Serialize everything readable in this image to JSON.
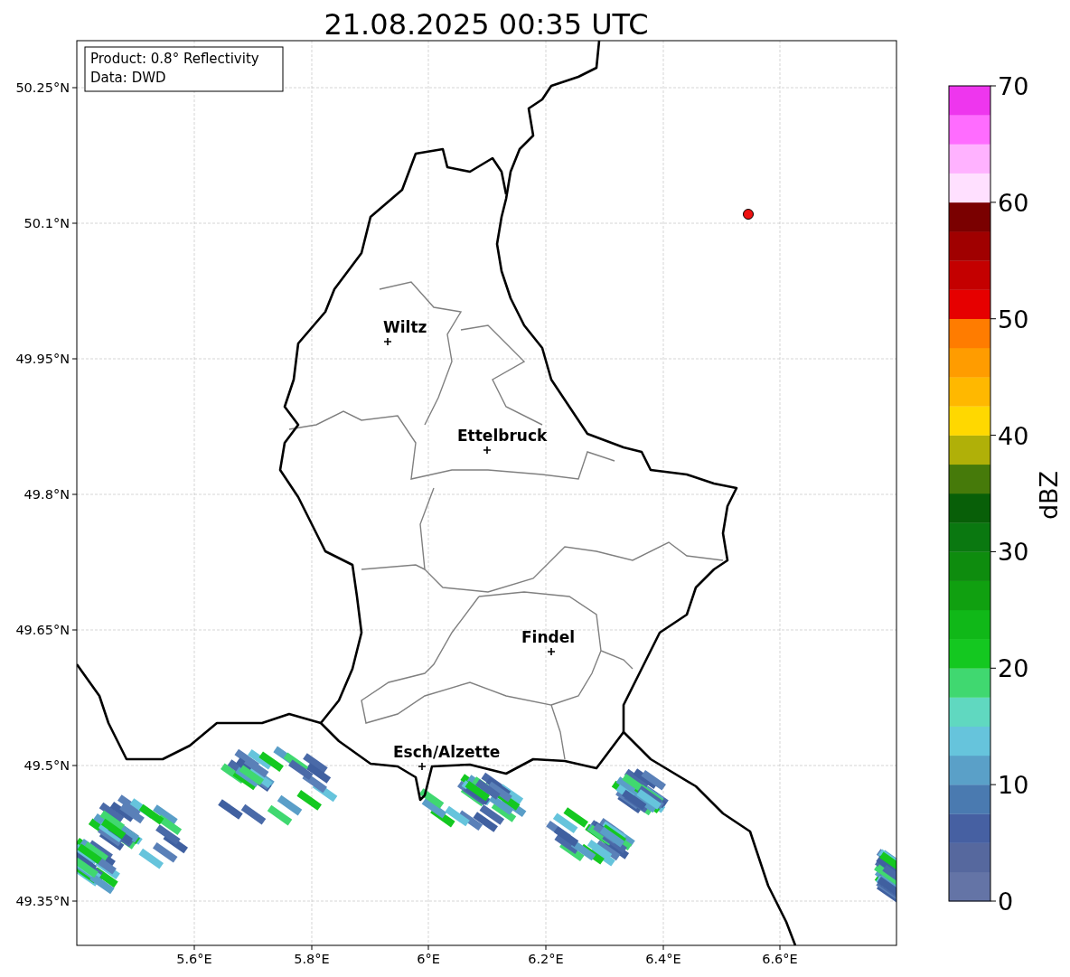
{
  "title": "21.08.2025 00:35 UTC",
  "info_box": [
    "Product: 0.8° Reflectivity",
    "Data: DWD"
  ],
  "map": {
    "y_ticks": [
      "50.25°N",
      "50.1°N",
      "49.95°N",
      "49.8°N",
      "49.65°N",
      "49.5°N",
      "49.35°N"
    ],
    "x_ticks": [
      "5.6°E",
      "5.8°E",
      "6°E",
      "6.2°E",
      "6.4°E",
      "6.6°E"
    ],
    "cities": [
      {
        "name": "Wiltz"
      },
      {
        "name": "Ettelbruck"
      },
      {
        "name": "Findel"
      },
      {
        "name": "Esch/Alzette"
      }
    ]
  },
  "colorbar": {
    "label": "dBZ",
    "ticks": [
      "70",
      "60",
      "50",
      "40",
      "30",
      "20",
      "10",
      "0"
    ],
    "bands": [
      {
        "color": "#6474a6"
      },
      {
        "color": "#56689e"
      },
      {
        "color": "#4660a2"
      },
      {
        "color": "#4a7ab0"
      },
      {
        "color": "#5aa0c8"
      },
      {
        "color": "#66c4dc"
      },
      {
        "color": "#60d8c0"
      },
      {
        "color": "#40d870"
      },
      {
        "color": "#14c820"
      },
      {
        "color": "#10b818"
      },
      {
        "color": "#10a010"
      },
      {
        "color": "#0e8c0e"
      },
      {
        "color": "#0a7810"
      },
      {
        "color": "#085f08"
      },
      {
        "color": "#467a0a"
      },
      {
        "color": "#b0b008"
      },
      {
        "color": "#ffd800"
      },
      {
        "color": "#ffb800"
      },
      {
        "color": "#ff9c00"
      },
      {
        "color": "#ff7c00"
      },
      {
        "color": "#e60000"
      },
      {
        "color": "#c40000"
      },
      {
        "color": "#a00000"
      },
      {
        "color": "#7a0000"
      },
      {
        "color": "#ffe0ff"
      },
      {
        "color": "#ffb2ff"
      },
      {
        "color": "#ff6cff"
      },
      {
        "color": "#ee36ee"
      }
    ]
  }
}
